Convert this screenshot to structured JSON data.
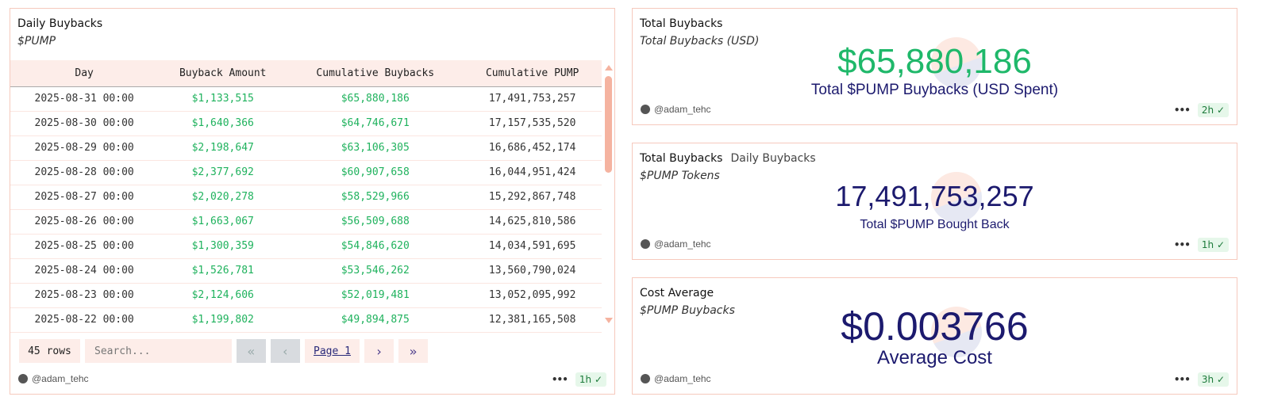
{
  "table_panel": {
    "title": "Daily Buybacks",
    "subtitle": "$PUMP",
    "columns": [
      "Day",
      "Buyback Amount",
      "Cumulative Buybacks",
      "Cumulative PUMP"
    ],
    "rows": [
      [
        "2025-08-31 00:00",
        "$1,133,515",
        "$65,880,186",
        "17,491,753,257"
      ],
      [
        "2025-08-30 00:00",
        "$1,640,366",
        "$64,746,671",
        "17,157,535,520"
      ],
      [
        "2025-08-29 00:00",
        "$2,198,647",
        "$63,106,305",
        "16,686,452,174"
      ],
      [
        "2025-08-28 00:00",
        "$2,377,692",
        "$60,907,658",
        "16,044,951,424"
      ],
      [
        "2025-08-27 00:00",
        "$2,020,278",
        "$58,529,966",
        "15,292,867,748"
      ],
      [
        "2025-08-26 00:00",
        "$1,663,067",
        "$56,509,688",
        "14,625,810,586"
      ],
      [
        "2025-08-25 00:00",
        "$1,300,359",
        "$54,846,620",
        "14,034,591,695"
      ],
      [
        "2025-08-24 00:00",
        "$1,526,781",
        "$53,546,262",
        "13,560,790,024"
      ],
      [
        "2025-08-23 00:00",
        "$2,124,606",
        "$52,019,481",
        "13,052,095,992"
      ],
      [
        "2025-08-22 00:00",
        "$1,199,802",
        "$49,894,875",
        "12,381,165,508"
      ]
    ],
    "row_count": "45 rows",
    "search_placeholder": "Search...",
    "page_label": "Page 1",
    "author": "@adam_tehc",
    "age": "1h"
  },
  "counter1": {
    "title": "Total Buybacks",
    "subtitle": "Total Buybacks (USD)",
    "value": "$65,880,186",
    "label": "Total $PUMP Buybacks (USD Spent)",
    "author": "@adam_tehc",
    "age": "2h",
    "value_color": "#1fb86a"
  },
  "counter2": {
    "tabs": [
      "Total Buybacks",
      "Daily Buybacks"
    ],
    "subtitle": "$PUMP Tokens",
    "value": "17,491,753,257",
    "label": "Total $PUMP Bought Back",
    "author": "@adam_tehc",
    "age": "1h",
    "value_color": "#1c1a6e"
  },
  "counter3": {
    "title": "Cost Average",
    "subtitle": "$PUMP Buybacks",
    "value": "$0.003766",
    "label": "Average Cost",
    "author": "@adam_tehc",
    "age": "3h",
    "value_color": "#1c1a6e"
  }
}
